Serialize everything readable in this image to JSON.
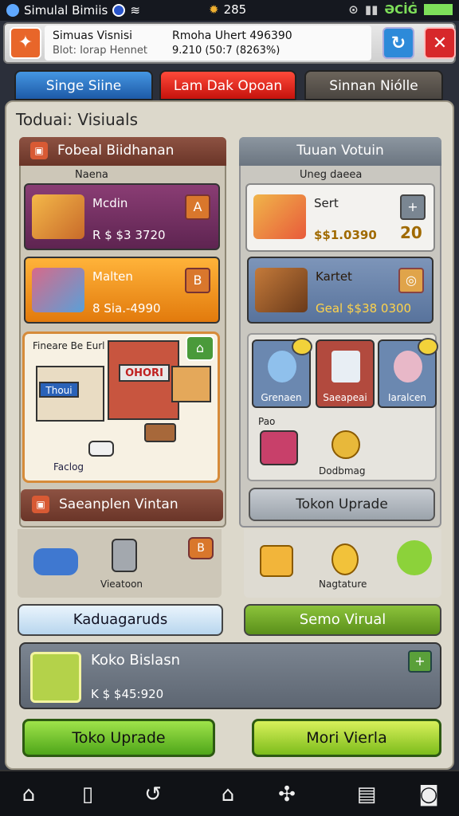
{
  "status": {
    "app": "Simulal Bimiis",
    "center": "285",
    "right": "ƏCİĠ"
  },
  "topbar": {
    "line1": "Simuas Visnisi",
    "line2": "Blot: Iorap Hennet",
    "line3": "Rmoha Uhert 496390",
    "line4": "9.210 (50:7 (8263%)"
  },
  "tabs": [
    "Singe Siine",
    "Lam Dak Opoan",
    "Sinnan Niólle"
  ],
  "panel_title": "Toduai: Visiuals",
  "left": {
    "header": "Fobeal Biidhanan",
    "sub": "Naena",
    "market": {
      "title": "Mcdin",
      "value": "R $ $3 3720",
      "btn": "A"
    },
    "maker": {
      "title": "Malten",
      "value": "8 Sia.-4990",
      "btn": "B"
    },
    "town": {
      "label": "Fineare Be Eurl",
      "foot": "Faclog",
      "sign": "OHORI",
      "sign2": "Thoui"
    },
    "section2": "Saeanplen Vintan"
  },
  "right": {
    "header": "Tuuan Votuin",
    "sub": "Uneg daeea",
    "sert": {
      "title": "Sert",
      "value": "$$1.0390",
      "num": "20",
      "btn": "+"
    },
    "kartet": {
      "title": "Kartet",
      "value": "Geal $$38 0300"
    },
    "items": [
      "Grenaen",
      "Saeapeai",
      "Iaralcen"
    ],
    "pao": "Pao",
    "dodng": "Dodbmag",
    "upgrade": "Tokon Uprade"
  },
  "belt": {
    "left_label": "Vieatoon",
    "left_btn": "B",
    "right_label": "Nagtature"
  },
  "buttons": {
    "kaduag": "Kaduagaruds",
    "semo": "Semo Virual"
  },
  "koko": {
    "title": "Koko Bislasn",
    "value": "K $ $45:920",
    "btn": "+"
  },
  "bottom": {
    "toko": "Toko Uprade",
    "mori": "Mori Vierla"
  },
  "icons": {
    "app": "app-orange-icon",
    "refresh": "refresh-icon",
    "close": "close-icon",
    "home": "home-icon",
    "phone": "phone-icon",
    "undo": "undo-icon",
    "cup": "cup-icon",
    "puzzle": "puzzle-icon",
    "box": "box-icon",
    "camera": "camera-icon"
  },
  "colors": {
    "accent_red": "#d7282b",
    "accent_blue": "#2d8ad9",
    "green": "#5aa03a"
  }
}
